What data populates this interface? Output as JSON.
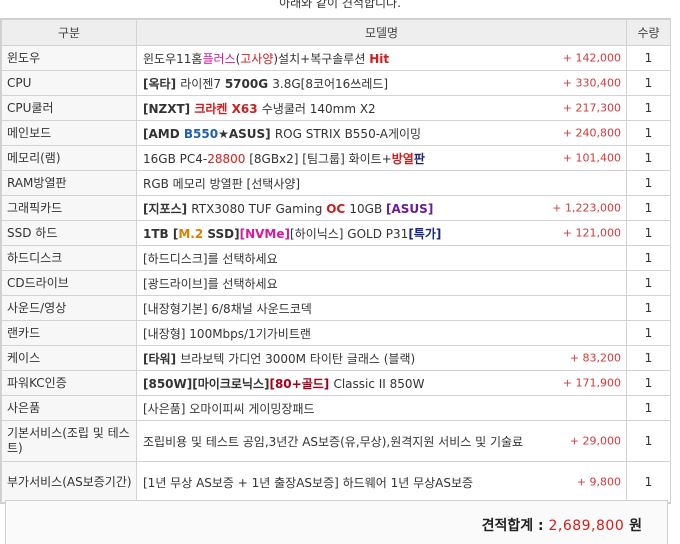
{
  "top_note": "아래와 같이 견적합니다.",
  "headers": {
    "category": "구분",
    "model": "모델명",
    "qty": "수량"
  },
  "rows": [
    {
      "category": "윈도우",
      "parts": [
        {
          "t": "윈도우11홈",
          "c": "#333333",
          "b": false
        },
        {
          "t": "플러스",
          "c": "#d61a9c",
          "b": false
        },
        {
          "t": "(",
          "c": "#333333",
          "b": false
        },
        {
          "t": "고사양",
          "c": "#d21d1d",
          "b": false
        },
        {
          "t": ")설치+복구솔루션 ",
          "c": "#333333",
          "b": false
        },
        {
          "t": "Hit",
          "c": "#d21d1d",
          "b": true
        }
      ],
      "price": "+ 142,000",
      "qty": "1"
    },
    {
      "category": "CPU",
      "parts": [
        {
          "t": "[옥타] ",
          "c": "#333333",
          "b": true
        },
        {
          "t": "라이젠7 ",
          "c": "#333333",
          "b": false
        },
        {
          "t": "5700G ",
          "c": "#333333",
          "b": true
        },
        {
          "t": "3.8G[8코어16쓰레드]",
          "c": "#333333",
          "b": false
        }
      ],
      "price": "+ 330,400",
      "qty": "1"
    },
    {
      "category": "CPU쿨러",
      "parts": [
        {
          "t": "[NZXT] ",
          "c": "#333333",
          "b": true
        },
        {
          "t": "크라켄 X63 ",
          "c": "#d21d1d",
          "b": true
        },
        {
          "t": "수냉쿨러 140mm X2",
          "c": "#333333",
          "b": false
        }
      ],
      "price": "+ 217,300",
      "qty": "1"
    },
    {
      "category": "메인보드",
      "parts": [
        {
          "t": "[AMD ",
          "c": "#333333",
          "b": true
        },
        {
          "t": "B550",
          "c": "#1f5fb5",
          "b": true
        },
        {
          "t": "★ASUS] ",
          "c": "#333333",
          "b": true
        },
        {
          "t": "ROG STRIX B550-A게이밍",
          "c": "#333333",
          "b": false
        }
      ],
      "price": "+ 240,800",
      "qty": "1"
    },
    {
      "category": "메모리(램)",
      "parts": [
        {
          "t": "16GB PC4-",
          "c": "#333333",
          "b": false
        },
        {
          "t": "28800",
          "c": "#d21d1d",
          "b": false
        },
        {
          "t": " [8GBx2] [팀그룹] 화이트+",
          "c": "#333333",
          "b": false
        },
        {
          "t": "방열",
          "c": "#d21d1d",
          "b": true
        },
        {
          "t": "판",
          "c": "#1a237e",
          "b": true
        }
      ],
      "price": "+ 101,400",
      "qty": "1"
    },
    {
      "category": "RAM방열판",
      "parts": [
        {
          "t": "RGB 메모리 방열판 [선택사양]",
          "c": "#333333",
          "b": false
        }
      ],
      "price": "",
      "qty": "1"
    },
    {
      "category": "그래픽카드",
      "parts": [
        {
          "t": "[지포스] ",
          "c": "#333333",
          "b": true
        },
        {
          "t": "RTX3080 TUF Gaming ",
          "c": "#333333",
          "b": false
        },
        {
          "t": "OC ",
          "c": "#d21d1d",
          "b": true
        },
        {
          "t": "10GB ",
          "c": "#333333",
          "b": false
        },
        {
          "t": "[ASUS]",
          "c": "#6a1b9a",
          "b": true
        }
      ],
      "price": "+ 1,223,000",
      "qty": "1"
    },
    {
      "category": "SSD 하드",
      "parts": [
        {
          "t": "1TB ",
          "c": "#333333",
          "b": true
        },
        {
          "t": "[",
          "c": "#333333",
          "b": true
        },
        {
          "t": "M.2 ",
          "c": "#e07a00",
          "b": true
        },
        {
          "t": "SSD]",
          "c": "#333333",
          "b": true
        },
        {
          "t": "[NVMe]",
          "c": "#d61a9c",
          "b": true
        },
        {
          "t": "[하이닉스] GOLD P31",
          "c": "#333333",
          "b": false
        },
        {
          "t": "[특가]",
          "c": "#1a237e",
          "b": true
        }
      ],
      "price": "+ 121,000",
      "qty": "1"
    },
    {
      "category": "하드디스크",
      "parts": [
        {
          "t": "[하드디스크]를 선택하세요",
          "c": "#333333",
          "b": false
        }
      ],
      "price": "",
      "qty": "1"
    },
    {
      "category": "CD드라이브",
      "parts": [
        {
          "t": "[광드라이브]를 선택하세요",
          "c": "#333333",
          "b": false
        }
      ],
      "price": "",
      "qty": "1"
    },
    {
      "category": "사운드/영상",
      "parts": [
        {
          "t": "[내장형기본] 6/8채널 사운드코덱",
          "c": "#333333",
          "b": false
        }
      ],
      "price": "",
      "qty": "1"
    },
    {
      "category": "랜카드",
      "parts": [
        {
          "t": "[내장형] 100Mbps/1기가비트랜",
          "c": "#333333",
          "b": false
        }
      ],
      "price": "",
      "qty": "1"
    },
    {
      "category": "케이스",
      "parts": [
        {
          "t": "[타워] ",
          "c": "#333333",
          "b": true
        },
        {
          "t": "브라보텍 가디언 3000M 타이탄 글래스 (블랙)",
          "c": "#333333",
          "b": false
        }
      ],
      "price": "+ 83,200",
      "qty": "1"
    },
    {
      "category": "파워KC인증",
      "parts": [
        {
          "t": "[850W][마이크로닉스]",
          "c": "#333333",
          "b": true
        },
        {
          "t": "[80+골드] ",
          "c": "#a0001a",
          "b": true
        },
        {
          "t": "Classic II 850W",
          "c": "#333333",
          "b": false
        }
      ],
      "price": "+ 171,900",
      "qty": "1"
    },
    {
      "category": "사은품",
      "parts": [
        {
          "t": "[사은품] 오마이피씨 게이밍장패드",
          "c": "#333333",
          "b": false
        }
      ],
      "price": "",
      "qty": "1"
    },
    {
      "category": "기본서비스(조립 및 테스트)",
      "parts": [
        {
          "t": "조립비용 및 테스트 공임,3년간 AS보증(유,무상),원격지원 서비스 및 기술료",
          "c": "#333333",
          "b": false
        }
      ],
      "price": "+ 29,000",
      "qty": "1",
      "tall": true
    },
    {
      "category": "부가서비스(AS보증기간)",
      "parts": [
        {
          "t": "[1년 무상 AS보증 + 1년 출장AS보증] 하드웨어 1년 무상AS보증",
          "c": "#333333",
          "b": false
        }
      ],
      "price": "+ 9,800",
      "qty": "1",
      "tall": true
    }
  ],
  "total": {
    "label": "견적합계  :  ",
    "amount": "2,689,800",
    "unit": " 원"
  }
}
